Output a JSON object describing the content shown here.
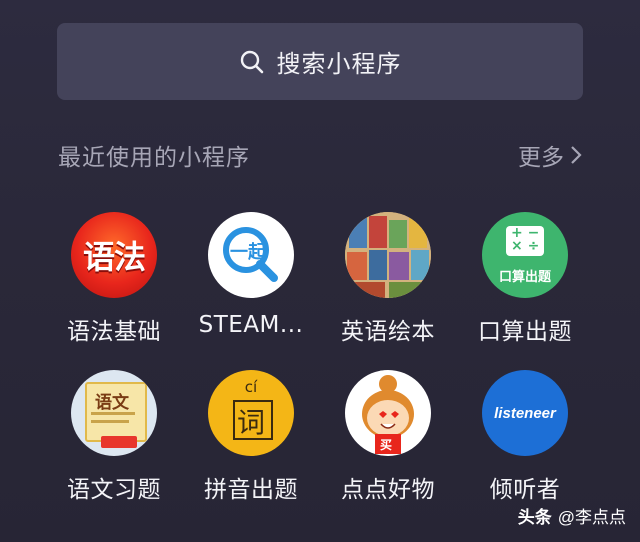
{
  "search": {
    "label": "搜索小程序"
  },
  "recent": {
    "title": "最近使用的小程序",
    "more_label": "更多"
  },
  "apps": [
    {
      "label": "语法基础",
      "icon_text": "语法"
    },
    {
      "label": "STEAM...",
      "icon_text": "一起"
    },
    {
      "label": "英语绘本"
    },
    {
      "label": "口算出题",
      "icon_text": "口算出题"
    },
    {
      "label": "语文习题",
      "icon_text": "语文"
    },
    {
      "label": "拼音出题",
      "icon_text": "词",
      "icon_sub": "cí"
    },
    {
      "label": "点点好物",
      "icon_text": "买"
    },
    {
      "label": "倾听者",
      "icon_text": "listeneer"
    }
  ],
  "watermark": {
    "brand": "头条",
    "handle": "@李点点"
  },
  "colors": {
    "background": "#2a2839",
    "search_bar": "#44435a",
    "grammar_red": "#e8261c",
    "steam_blue": "#2a92e0",
    "math_green": "#3eb56e",
    "pinyin_yellow": "#f4b616",
    "listener_blue": "#1d6fd6"
  }
}
